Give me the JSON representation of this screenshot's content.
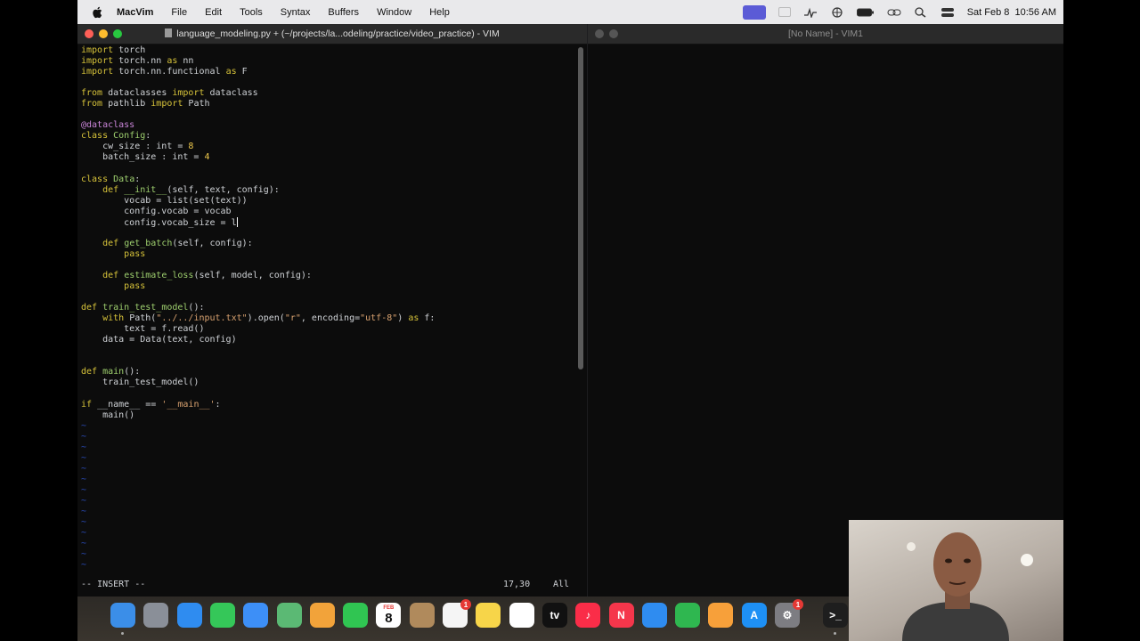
{
  "menubar": {
    "app_name": "MacVim",
    "items": [
      "File",
      "Edit",
      "Tools",
      "Syntax",
      "Buffers",
      "Window",
      "Help"
    ],
    "clock": "Sat Feb 8  10:56 AM"
  },
  "left_window": {
    "title": "language_modeling.py + (~/projects/la...odeling/practice/video_practice) - VIM",
    "mode": "-- INSERT --",
    "position": "17,30",
    "scroll": "All"
  },
  "right_window": {
    "title": "[No Name] - VIM1"
  },
  "code_lines": [
    [
      [
        "kw",
        "import"
      ],
      [
        "t",
        " torch"
      ]
    ],
    [
      [
        "kw",
        "import"
      ],
      [
        "t",
        " torch.nn "
      ],
      [
        "kw",
        "as"
      ],
      [
        "t",
        " nn"
      ]
    ],
    [
      [
        "kw",
        "import"
      ],
      [
        "t",
        " torch.nn.functional "
      ],
      [
        "kw",
        "as"
      ],
      [
        "t",
        " F"
      ]
    ],
    [],
    [
      [
        "kw",
        "from"
      ],
      [
        "t",
        " dataclasses "
      ],
      [
        "kw",
        "import"
      ],
      [
        "t",
        " dataclass"
      ]
    ],
    [
      [
        "kw",
        "from"
      ],
      [
        "t",
        " pathlib "
      ],
      [
        "kw",
        "import"
      ],
      [
        "t",
        " Path"
      ]
    ],
    [],
    [
      [
        "deco",
        "@dataclass"
      ]
    ],
    [
      [
        "kw",
        "class"
      ],
      [
        "t",
        " "
      ],
      [
        "fn",
        "Config"
      ],
      [
        "t",
        ":"
      ]
    ],
    [
      [
        "t",
        "    cw_size : int = "
      ],
      [
        "num",
        "8"
      ]
    ],
    [
      [
        "t",
        "    batch_size : int = "
      ],
      [
        "num",
        "4"
      ]
    ],
    [],
    [
      [
        "kw",
        "class"
      ],
      [
        "t",
        " "
      ],
      [
        "fn",
        "Data"
      ],
      [
        "t",
        ":"
      ]
    ],
    [
      [
        "t",
        "    "
      ],
      [
        "kw",
        "def"
      ],
      [
        "t",
        " "
      ],
      [
        "fn",
        "__init__"
      ],
      [
        "t",
        "(self, text, config):"
      ]
    ],
    [
      [
        "t",
        "        vocab = list(set(text))"
      ]
    ],
    [
      [
        "t",
        "        config.vocab = vocab"
      ]
    ],
    [
      [
        "t",
        "        config.vocab_size = l"
      ]
    ],
    [],
    [
      [
        "t",
        "    "
      ],
      [
        "kw",
        "def"
      ],
      [
        "t",
        " "
      ],
      [
        "fn",
        "get_batch"
      ],
      [
        "t",
        "(self, config):"
      ]
    ],
    [
      [
        "t",
        "        "
      ],
      [
        "kw",
        "pass"
      ]
    ],
    [],
    [
      [
        "t",
        "    "
      ],
      [
        "kw",
        "def"
      ],
      [
        "t",
        " "
      ],
      [
        "fn",
        "estimate_loss"
      ],
      [
        "t",
        "(self, model, config):"
      ]
    ],
    [
      [
        "t",
        "        "
      ],
      [
        "kw",
        "pass"
      ]
    ],
    [],
    [
      [
        "kw",
        "def"
      ],
      [
        "t",
        " "
      ],
      [
        "fn",
        "train_test_model"
      ],
      [
        "t",
        "():"
      ]
    ],
    [
      [
        "t",
        "    "
      ],
      [
        "kw",
        "with"
      ],
      [
        "t",
        " Path("
      ],
      [
        "str",
        "\"../../input.txt\""
      ],
      [
        "t",
        ").open("
      ],
      [
        "str",
        "\"r\""
      ],
      [
        "t",
        ", encoding="
      ],
      [
        "str",
        "\"utf-8\""
      ],
      [
        "t",
        ") "
      ],
      [
        "kw",
        "as"
      ],
      [
        "t",
        " f:"
      ]
    ],
    [
      [
        "t",
        "        text = f.read()"
      ]
    ],
    [
      [
        "t",
        "    data = Data(text, config)"
      ]
    ],
    [],
    [],
    [
      [
        "kw",
        "def"
      ],
      [
        "t",
        " "
      ],
      [
        "fn",
        "main"
      ],
      [
        "t",
        "():"
      ]
    ],
    [
      [
        "t",
        "    train_test_model()"
      ]
    ],
    [],
    [
      [
        "kw",
        "if"
      ],
      [
        "t",
        " __name__ == "
      ],
      [
        "str",
        "'__main__'"
      ],
      [
        "t",
        ":"
      ]
    ],
    [
      [
        "t",
        "    main()"
      ]
    ]
  ],
  "tilde_char": "~",
  "dock": [
    {
      "name": "finder-icon",
      "color": "#3b8ee8",
      "label": ""
    },
    {
      "name": "launchpad-icon",
      "color": "#8a8f98",
      "label": ""
    },
    {
      "name": "safari-icon",
      "color": "#2f8cf0",
      "label": ""
    },
    {
      "name": "messages-icon",
      "color": "#35c759",
      "label": ""
    },
    {
      "name": "mail-icon",
      "color": "#3d8ff7",
      "label": ""
    },
    {
      "name": "maps-icon",
      "color": "#5bb974",
      "label": ""
    },
    {
      "name": "photos-icon",
      "color": "#f2a33a",
      "label": ""
    },
    {
      "name": "facetime-icon",
      "color": "#30c552",
      "label": ""
    },
    {
      "name": "calendar-icon",
      "color": "#ffffff",
      "label": "8"
    },
    {
      "name": "contacts-icon",
      "color": "#b08a5c",
      "label": ""
    },
    {
      "name": "reminders-icon",
      "color": "#f5f5f5",
      "label": ""
    },
    {
      "name": "notes-icon",
      "color": "#f7d549",
      "label": ""
    },
    {
      "name": "freeform-icon",
      "color": "#ffffff",
      "label": ""
    },
    {
      "name": "appletv-icon",
      "color": "#111111",
      "label": "tv"
    },
    {
      "name": "music-icon",
      "color": "#fa2d48",
      "label": "♪"
    },
    {
      "name": "news-icon",
      "color": "#f5364b",
      "label": "N"
    },
    {
      "name": "keynote-icon",
      "color": "#2f8cf0",
      "label": ""
    },
    {
      "name": "numbers-icon",
      "color": "#2fb750",
      "label": ""
    },
    {
      "name": "pages-icon",
      "color": "#f7a03a",
      "label": ""
    },
    {
      "name": "appstore-icon",
      "color": "#1e90f5",
      "label": "A"
    },
    {
      "name": "system-settings-icon",
      "color": "#7d7d82",
      "label": "⚙"
    },
    {
      "name": "terminal-icon",
      "color": "#1e1e1e",
      "label": ">_"
    }
  ],
  "calendar_month": "FEB",
  "badge_count": "1"
}
